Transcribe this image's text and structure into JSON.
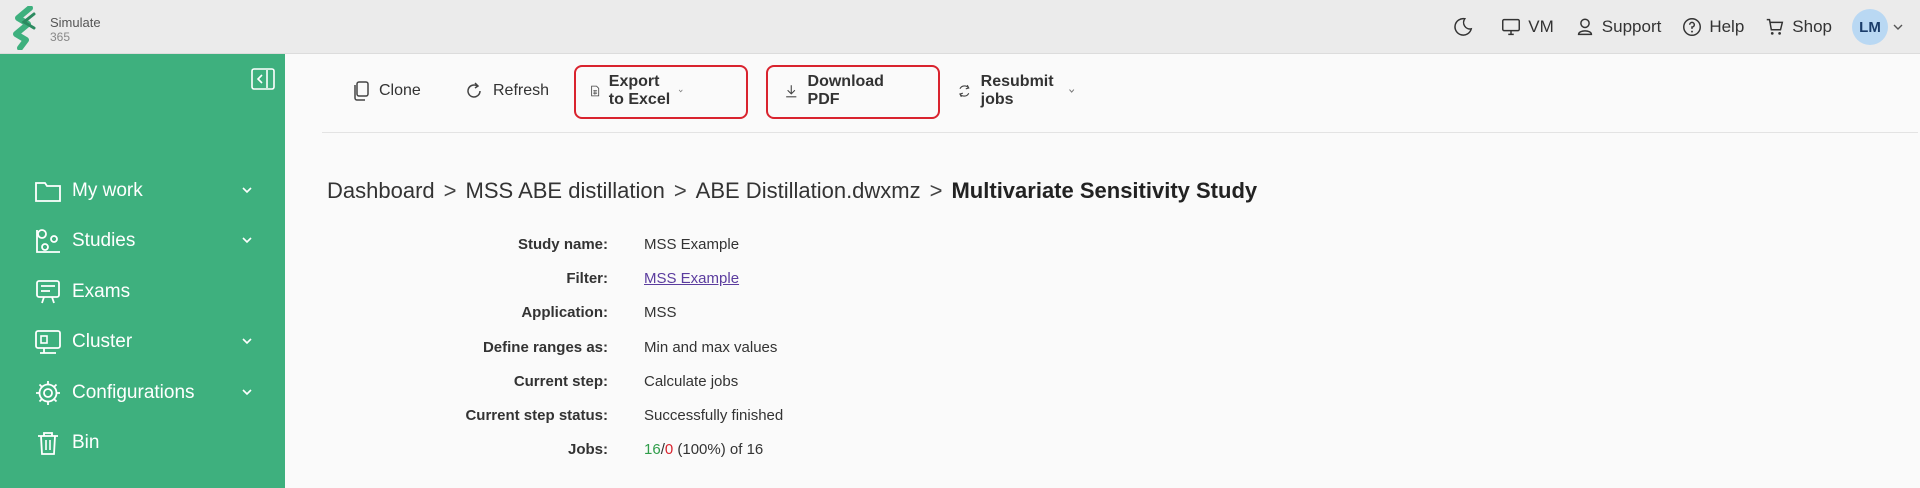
{
  "app": {
    "logo_name": "Simulate",
    "logo_sub": "365"
  },
  "topbar": {
    "items": [
      {
        "label": "",
        "icon": "moon-icon"
      },
      {
        "label": "VM",
        "icon": "monitor-icon"
      },
      {
        "label": "Support",
        "icon": "support-icon"
      },
      {
        "label": "Help",
        "icon": "help-icon"
      },
      {
        "label": "Shop",
        "icon": "cart-icon"
      }
    ],
    "avatar": "LM"
  },
  "sidebar": {
    "items": [
      {
        "label": "My work",
        "icon": "folder-icon",
        "expandable": true
      },
      {
        "label": "Studies",
        "icon": "studies-icon",
        "expandable": true
      },
      {
        "label": "Exams",
        "icon": "exams-icon",
        "expandable": false
      },
      {
        "label": "Cluster",
        "icon": "cluster-icon",
        "expandable": true
      },
      {
        "label": "Configurations",
        "icon": "gear-icon",
        "expandable": true
      },
      {
        "label": "Bin",
        "icon": "trash-icon",
        "expandable": false
      }
    ]
  },
  "toolbar": {
    "clone": "Clone",
    "refresh": "Refresh",
    "export_excel": "Export to Excel",
    "download_pdf": "Download PDF",
    "resubmit": "Resubmit jobs"
  },
  "breadcrumb": {
    "items": [
      "Dashboard",
      "MSS ABE distillation",
      "ABE Distillation.dwxmz"
    ],
    "current": "Multivariate Sensitivity Study",
    "separator": ">"
  },
  "details": {
    "study_name_label": "Study name:",
    "study_name": "MSS Example",
    "filter_label": "Filter:",
    "filter": "MSS Example",
    "application_label": "Application:",
    "application": "MSS",
    "ranges_label": "Define ranges as:",
    "ranges": "Min and max values",
    "step_label": "Current step:",
    "step": "Calculate jobs",
    "status_label": "Current step status:",
    "status": "Successfully finished",
    "jobs_label": "Jobs:",
    "jobs_done": "16",
    "jobs_slash": "/",
    "jobs_failed": "0",
    "jobs_rest": " (100%) of 16"
  },
  "colors": {
    "sidebar": "#3eb07e",
    "highlight": "#d9232e",
    "success": "#2f9d4a"
  }
}
